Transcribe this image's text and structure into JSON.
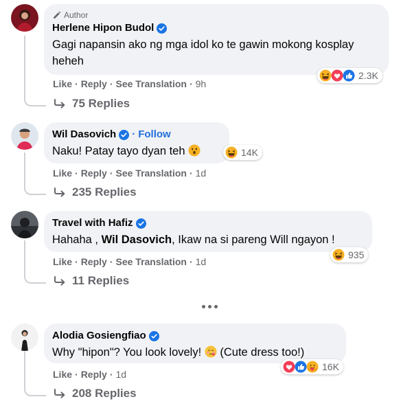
{
  "comments": [
    {
      "badge": "Author",
      "name": "Herlene Hipon Budol",
      "text": "Gagi napansin ako ng mga idol ko te gawin mokong kosplay heheh",
      "reactions_count": "2.3K",
      "actions": [
        "Like",
        "Reply",
        "See Translation"
      ],
      "time": "9h",
      "replies": "75 Replies"
    },
    {
      "name": "Wil Dasovich",
      "follow": "Follow",
      "text": "Naku! Patay tayo dyan teh",
      "reactions_count": "14K",
      "actions": [
        "Like",
        "Reply",
        "See Translation"
      ],
      "time": "1d",
      "replies": "235 Replies"
    },
    {
      "name": "Travel with Hafiz",
      "text_before": "Hahaha , ",
      "mention": "Wil Dasovich",
      "text_after": ", Ikaw na si pareng Will ngayon !",
      "reactions_count": "935",
      "actions": [
        "Like",
        "Reply",
        "See Translation"
      ],
      "time": "1d",
      "replies": "11 Replies"
    },
    {
      "name": "Alodia Gosiengfiao",
      "text_before": "Why \"hipon\"? You look lovely!",
      "text_after": "(Cute dress too!)",
      "reactions_count": "16K",
      "actions": [
        "Like",
        "Reply"
      ],
      "time": "1d",
      "replies": "208 Replies"
    }
  ],
  "colors": {
    "link_blue": "#216fdb",
    "bubble": "#f0f2f5",
    "muted": "#65676b",
    "verified": "#1b74e4"
  }
}
